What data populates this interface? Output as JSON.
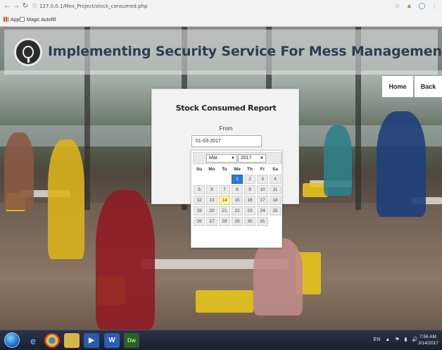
{
  "browser": {
    "url": "127.0.0.1/Mes_Project/stock_consumed.php",
    "bookmarks": [
      {
        "label": "Apps"
      },
      {
        "label": "Magic Autofill"
      }
    ]
  },
  "header": {
    "title": "Implementing Security Service For Mess Management System Using PHP."
  },
  "nav": {
    "home": "Home",
    "back": "Back"
  },
  "report": {
    "title": "Stock Consumed Report",
    "from_label": "From",
    "from_value": "01-03-2017"
  },
  "datepicker": {
    "month": "Mar",
    "year": "2017",
    "weekdays": [
      "Su",
      "Mo",
      "Tu",
      "We",
      "Th",
      "Fr",
      "Sa"
    ],
    "first_weekday_index": 3,
    "days_in_month": 31,
    "selected_day": 1,
    "today_day": 14
  },
  "taskbar": {
    "apps": [
      "ie-icon",
      "chrome-icon",
      "explorer-icon",
      "media-icon",
      "word-icon",
      "dreamweaver-icon"
    ],
    "dw_label": "Dw",
    "tray_lang": "EN",
    "time": "7:56 AM",
    "date": "3/14/2017"
  },
  "colors": {
    "title_text": "#2d3e52",
    "selected_day": "#2b7ddb",
    "today_day": "#fbf39c"
  }
}
